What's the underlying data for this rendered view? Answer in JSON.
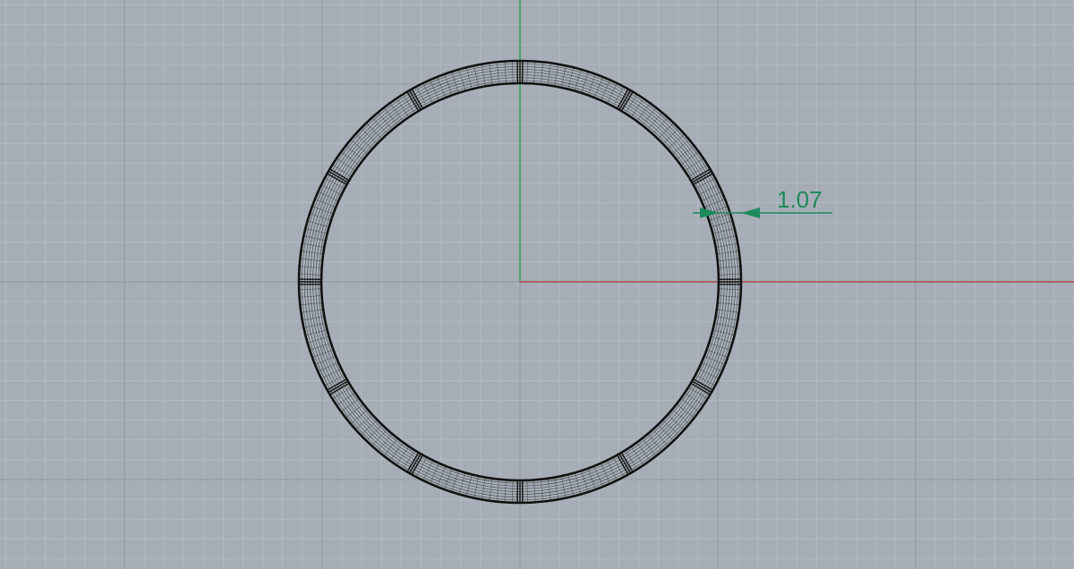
{
  "viewport": {
    "view": "top",
    "background_color": "#a6adb7",
    "grid_minor_color": "#b3b9c2",
    "grid_major_color": "#959ca6",
    "x_axis_color": "#b5372f",
    "y_axis_color": "#1f9a3a",
    "object_color": "#111111",
    "object_type": "ring",
    "ring_segments": 12
  },
  "dimension": {
    "value_label": "1.07",
    "color": "#1d8a5c"
  }
}
